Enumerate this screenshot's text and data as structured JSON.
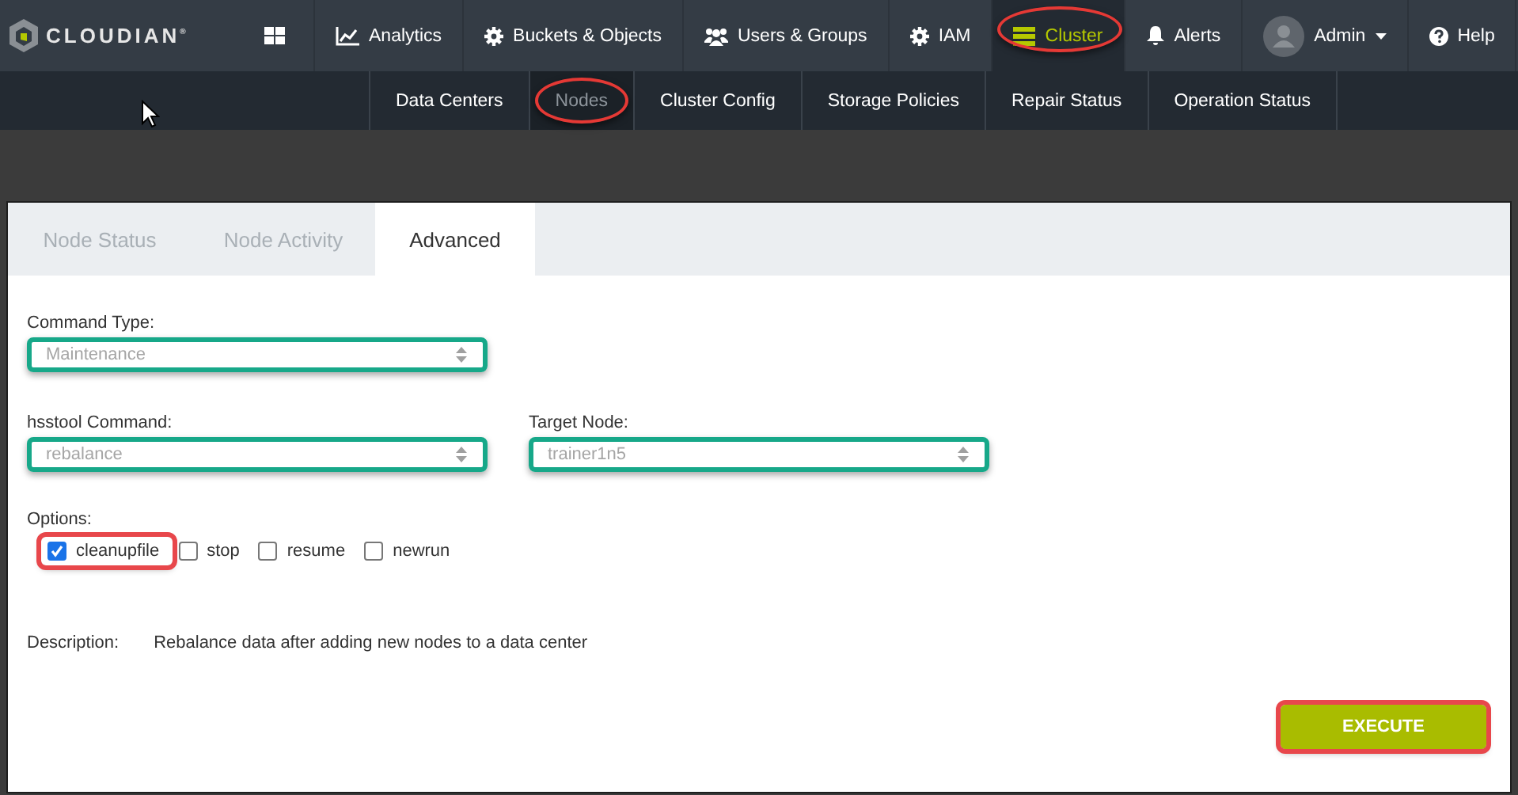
{
  "logo": {
    "text": "CLOUDIAN$^{®}$"
  },
  "nav": [
    {
      "selected": false,
      "highlighted": false
    },
    {
      "label": "Analytics",
      "selected": false,
      "highlighted": false
    },
    {
      "label": "Buckets & Objects",
      "selected": false,
      "highlighted": false
    },
    {
      "label": "Users & Groups",
      "selected": false,
      "highlighted": false
    },
    {
      "label": "IAM",
      "selected": false,
      "highlighted": false
    },
    {
      "label": "Cluster",
      "selected": true,
      "highlighted": true
    },
    {
      "label": "Alerts",
      "selected": false,
      "highlighted": false
    },
    {
      "label": "Admin",
      "dropdown": true,
      "selected": false,
      "highlighted": false
    },
    {
      "label": "Help",
      "selected": false,
      "highlighted": false
    }
  ],
  "subnav": [
    {
      "label": "Data Centers",
      "selected": false,
      "highlighted": false
    },
    {
      "label": "Nodes",
      "selected": true,
      "highlighted": true
    },
    {
      "label": "Cluster Config",
      "selected": false,
      "highlighted": false
    },
    {
      "label": "Storage Policies",
      "selected": false,
      "highlighted": false
    },
    {
      "label": "Repair Status",
      "selected": false,
      "highlighted": false
    },
    {
      "label": "Operation Status",
      "selected": false,
      "highlighted": false
    }
  ],
  "tabs": [
    {
      "label": "Node Status",
      "selected": false
    },
    {
      "label": "Node Activity",
      "selected": false
    },
    {
      "label": "Advanced",
      "selected": true
    }
  ],
  "form": {
    "command_type": {
      "label": "Command Type:",
      "value": "Maintenance",
      "highlighted": true
    },
    "hsstool_command": {
      "label": "hsstool Command:",
      "value": "rebalance",
      "highlighted": true
    },
    "target_node": {
      "label": "Target Node:",
      "value": "trainer1n5",
      "highlighted": true
    },
    "options": {
      "label": "Options:",
      "items": [
        {
          "label": "cleanupfile",
          "checked": true,
          "highlighted": true
        },
        {
          "label": "stop",
          "checked": false,
          "highlighted": false
        },
        {
          "label": "resume",
          "checked": false,
          "highlighted": false
        },
        {
          "label": "newrun",
          "checked": false,
          "highlighted": false
        }
      ]
    },
    "description": {
      "label": "Description:",
      "text": "Rebalance data after adding new nodes to a data center"
    },
    "execute_button": {
      "label": "EXECUTE",
      "highlighted": true
    }
  }
}
